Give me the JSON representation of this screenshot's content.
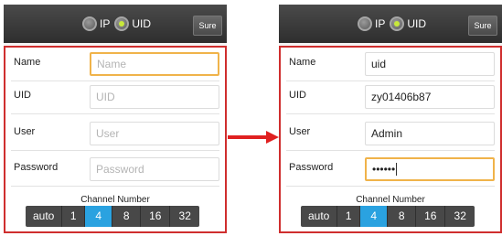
{
  "panels": [
    {
      "mode_options": {
        "ip_label": "IP",
        "uid_label": "UID"
      },
      "sure_label": "Sure",
      "fields": [
        {
          "label": "Name",
          "text": "Name",
          "is_placeholder": true
        },
        {
          "label": "UID",
          "text": "UID",
          "is_placeholder": true
        },
        {
          "label": "User",
          "text": "User",
          "is_placeholder": true
        },
        {
          "label": "Password",
          "text": "Password",
          "is_placeholder": true
        }
      ],
      "channel": {
        "title": "Channel Number",
        "options": [
          "auto",
          "1",
          "4",
          "8",
          "16",
          "32"
        ],
        "selected": "4"
      }
    },
    {
      "mode_options": {
        "ip_label": "IP",
        "uid_label": "UID"
      },
      "sure_label": "Sure",
      "fields": [
        {
          "label": "Name",
          "text": "uid",
          "is_placeholder": false
        },
        {
          "label": "UID",
          "text": "zy01406b87",
          "is_placeholder": false
        },
        {
          "label": "User",
          "text": "Admin",
          "is_placeholder": false
        },
        {
          "label": "Password",
          "text": "••••••",
          "is_placeholder": false
        }
      ],
      "channel": {
        "title": "Channel Number",
        "options": [
          "auto",
          "1",
          "4",
          "8",
          "16",
          "32"
        ],
        "selected": "4"
      }
    }
  ],
  "colors": {
    "highlight_frame": "#cf2e2e",
    "arrow": "#e02020",
    "selected_channel": "#2aa2e0",
    "focus_border": "#f0b34a",
    "radio_checked": "#c8e83a"
  }
}
